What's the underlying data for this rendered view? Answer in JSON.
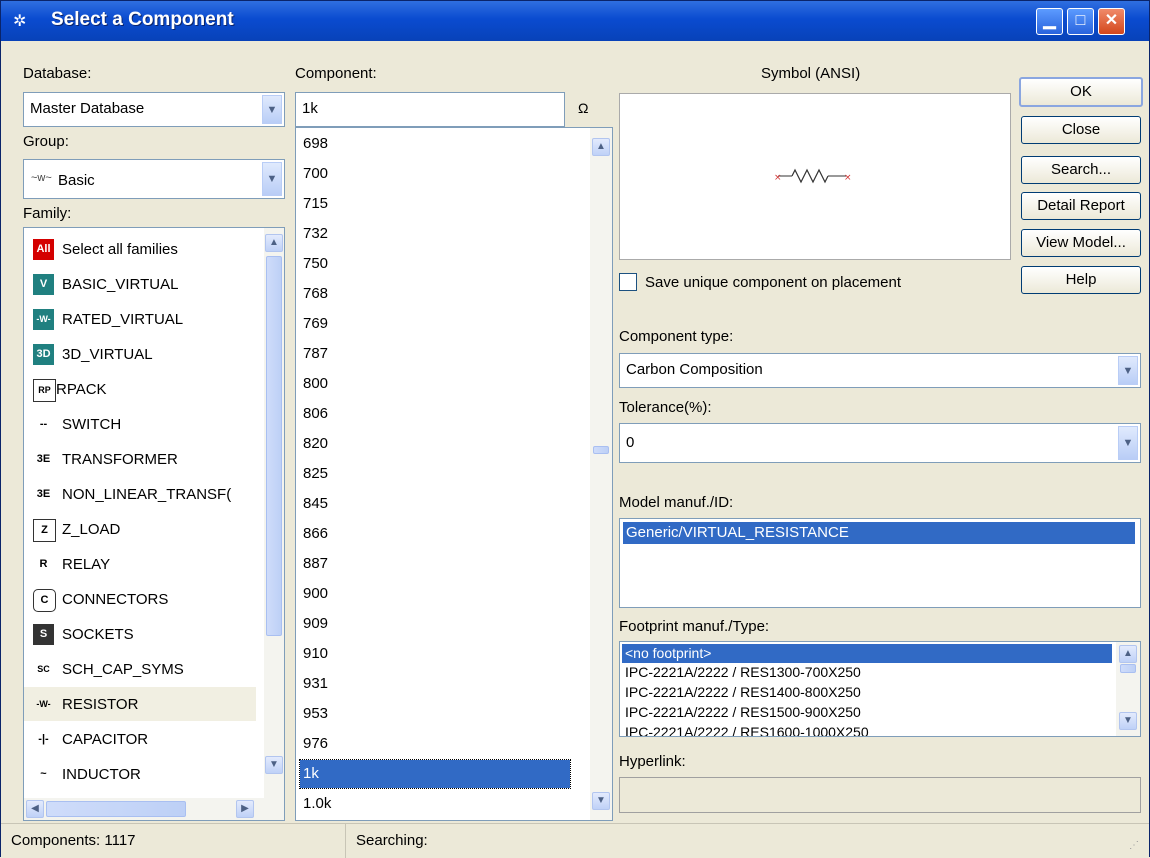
{
  "window": {
    "title": "Select a Component"
  },
  "database": {
    "label": "Database:",
    "value": "Master Database"
  },
  "group": {
    "label": "Group:",
    "value": "Basic"
  },
  "family": {
    "label": "Family:",
    "items": [
      {
        "icon": "All",
        "label": "Select all families"
      },
      {
        "icon": "V",
        "label": "BASIC_VIRTUAL"
      },
      {
        "icon": "-W-",
        "label": "RATED_VIRTUAL"
      },
      {
        "icon": "3D",
        "label": "3D_VIRTUAL"
      },
      {
        "icon": "RP",
        "label": "RPACK"
      },
      {
        "icon": "--",
        "label": "SWITCH"
      },
      {
        "icon": "3E",
        "label": "TRANSFORMER"
      },
      {
        "icon": "3E",
        "label": "NON_LINEAR_TRANSF("
      },
      {
        "icon": "Z",
        "label": "Z_LOAD"
      },
      {
        "icon": "R",
        "label": "RELAY"
      },
      {
        "icon": "C",
        "label": "CONNECTORS"
      },
      {
        "icon": "S",
        "label": "SOCKETS"
      },
      {
        "icon": "SC",
        "label": "SCH_CAP_SYMS"
      },
      {
        "icon": "-W-",
        "label": "RESISTOR"
      },
      {
        "icon": "-|-",
        "label": "CAPACITOR"
      },
      {
        "icon": "~",
        "label": "INDUCTOR"
      }
    ]
  },
  "component": {
    "label": "Component:",
    "value": "1k",
    "unit": "Ω",
    "items": [
      "698",
      "700",
      "715",
      "732",
      "750",
      "768",
      "769",
      "787",
      "800",
      "806",
      "820",
      "825",
      "845",
      "866",
      "887",
      "900",
      "909",
      "910",
      "931",
      "953",
      "976",
      "1k",
      "1.0k"
    ],
    "selected": "1k"
  },
  "symbol": {
    "label": "Symbol (ANSI)"
  },
  "save_unique": {
    "label": "Save unique component on placement"
  },
  "component_type": {
    "label": "Component type:",
    "value": "Carbon Composition"
  },
  "tolerance": {
    "label": "Tolerance(%):",
    "value": "0"
  },
  "model": {
    "label": "Model manuf./ID:",
    "items": [
      "Generic/VIRTUAL_RESISTANCE"
    ]
  },
  "footprint": {
    "label": "Footprint manuf./Type:",
    "items": [
      "<no footprint>",
      "IPC-2221A/2222 / RES1300-700X250",
      "IPC-2221A/2222 / RES1400-800X250",
      "IPC-2221A/2222 / RES1500-900X250",
      "IPC-2221A/2222 / RES1600-1000X250"
    ]
  },
  "hyperlink": {
    "label": "Hyperlink:",
    "value": ""
  },
  "buttons": {
    "ok": "OK",
    "close": "Close",
    "search": "Search...",
    "detail": "Detail Report",
    "view_model": "View Model...",
    "help": "Help"
  },
  "status": {
    "components": "Components: 1117",
    "searching": "Searching:"
  },
  "colors": {
    "selection": "#316ac5",
    "titlebar": "#0a4bd0",
    "dialog_bg": "#ece9d8"
  }
}
